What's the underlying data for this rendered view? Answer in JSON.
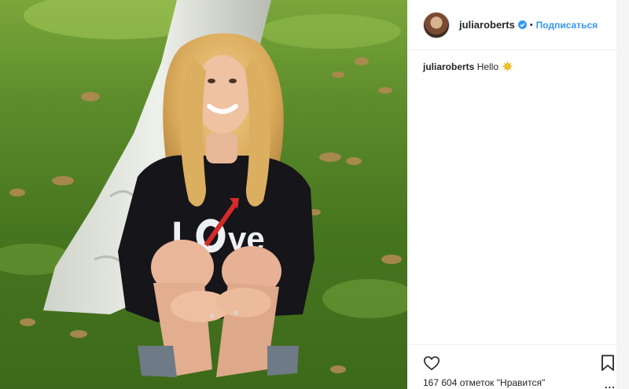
{
  "post": {
    "username": "juliaroberts",
    "verified_icon": "verified-badge-icon",
    "follow_label": "Подписаться",
    "dot": "•",
    "caption_user": "juliaroberts",
    "caption_text": "Hello",
    "caption_emoji": "sun-emoji-icon",
    "likes_text": "167 604 отметок \"Нравится\"",
    "more_label": "..."
  },
  "photo": {
    "shirt_text_1": "L",
    "shirt_text_2": "ve"
  },
  "colors": {
    "link": "#3897f0",
    "text": "#262626",
    "border": "#efefef",
    "grass": "#4e7d25"
  }
}
